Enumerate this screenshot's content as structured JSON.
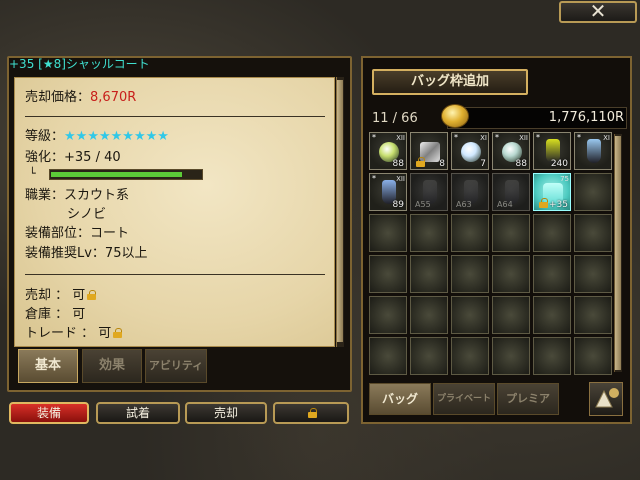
{
  "window": {
    "close_label": "✕"
  },
  "item": {
    "name": "+35 [★8]シャッルコート",
    "price_label": "売却価格：",
    "price_value": "8,670R",
    "rank_label": "等級：",
    "rank_stars": "★★★★★★★★★",
    "enhance_label": "強化：+35 / 40",
    "enhance_progress": 0.875,
    "tree_marker": "└",
    "job_label": "職業：スカウト系",
    "job_value2": "シノビ",
    "slot_label": "装備部位：コート",
    "level_label": "装備推奨Lv：75以上",
    "sell_label": "売却 ： 可",
    "storage_label": "倉庫 ： 可",
    "trade_label": "トレード ： 可"
  },
  "detail_tabs": [
    {
      "label": "基本",
      "active": true
    },
    {
      "label": "効果",
      "active": false
    },
    {
      "label": "アビリティ",
      "active": false
    }
  ],
  "actions": {
    "equip": "装備",
    "try_on": "試着",
    "sell": "売却"
  },
  "bag": {
    "expand_label": "バッグ枠追加",
    "capacity": "11 / 66",
    "money": "1,776,110R",
    "slots": [
      {
        "kind": "orb",
        "color": "#c8e070",
        "tag": "XII",
        "star": "*",
        "count": "88"
      },
      {
        "kind": "ring",
        "color": "#c0c0c0",
        "tag": "",
        "star": "",
        "count": "8",
        "locked": true
      },
      {
        "kind": "orb",
        "color": "#d0e8ff",
        "tag": "XI",
        "star": "*",
        "count": "7"
      },
      {
        "kind": "orb",
        "color": "#b8d8d0",
        "tag": "XII",
        "star": "*",
        "count": "88"
      },
      {
        "kind": "flask",
        "color": "#d8e020",
        "tag": "",
        "star": "*",
        "count": "240"
      },
      {
        "kind": "flask",
        "color": "#9ac8f0",
        "tag": "XI",
        "star": "*",
        "count": ""
      },
      {
        "kind": "flask",
        "color": "#8ab0e8",
        "tag": "XII",
        "star": "*",
        "count": "89"
      },
      {
        "kind": "dim",
        "color": "#5a5a58",
        "tag": "",
        "star": "",
        "count": "",
        "lvl": "A55"
      },
      {
        "kind": "dim",
        "color": "#5a5a58",
        "tag": "",
        "star": "",
        "count": "",
        "lvl": "A63"
      },
      {
        "kind": "dim",
        "color": "#5a5a58",
        "tag": "",
        "star": "",
        "count": "",
        "lvl": "A64"
      },
      {
        "kind": "selected",
        "color": "#6ae0d8",
        "tag": "75",
        "star": "",
        "count": "+35",
        "locked": true
      }
    ]
  },
  "bag_tabs": [
    {
      "label": "バッグ",
      "active": true
    },
    {
      "label": "プライベート",
      "active": false
    },
    {
      "label": "プレミア",
      "active": false
    }
  ],
  "icons": {
    "close": "close-icon",
    "lock": "lock-icon",
    "coin": "coin-icon",
    "sort": "sort-icon"
  }
}
